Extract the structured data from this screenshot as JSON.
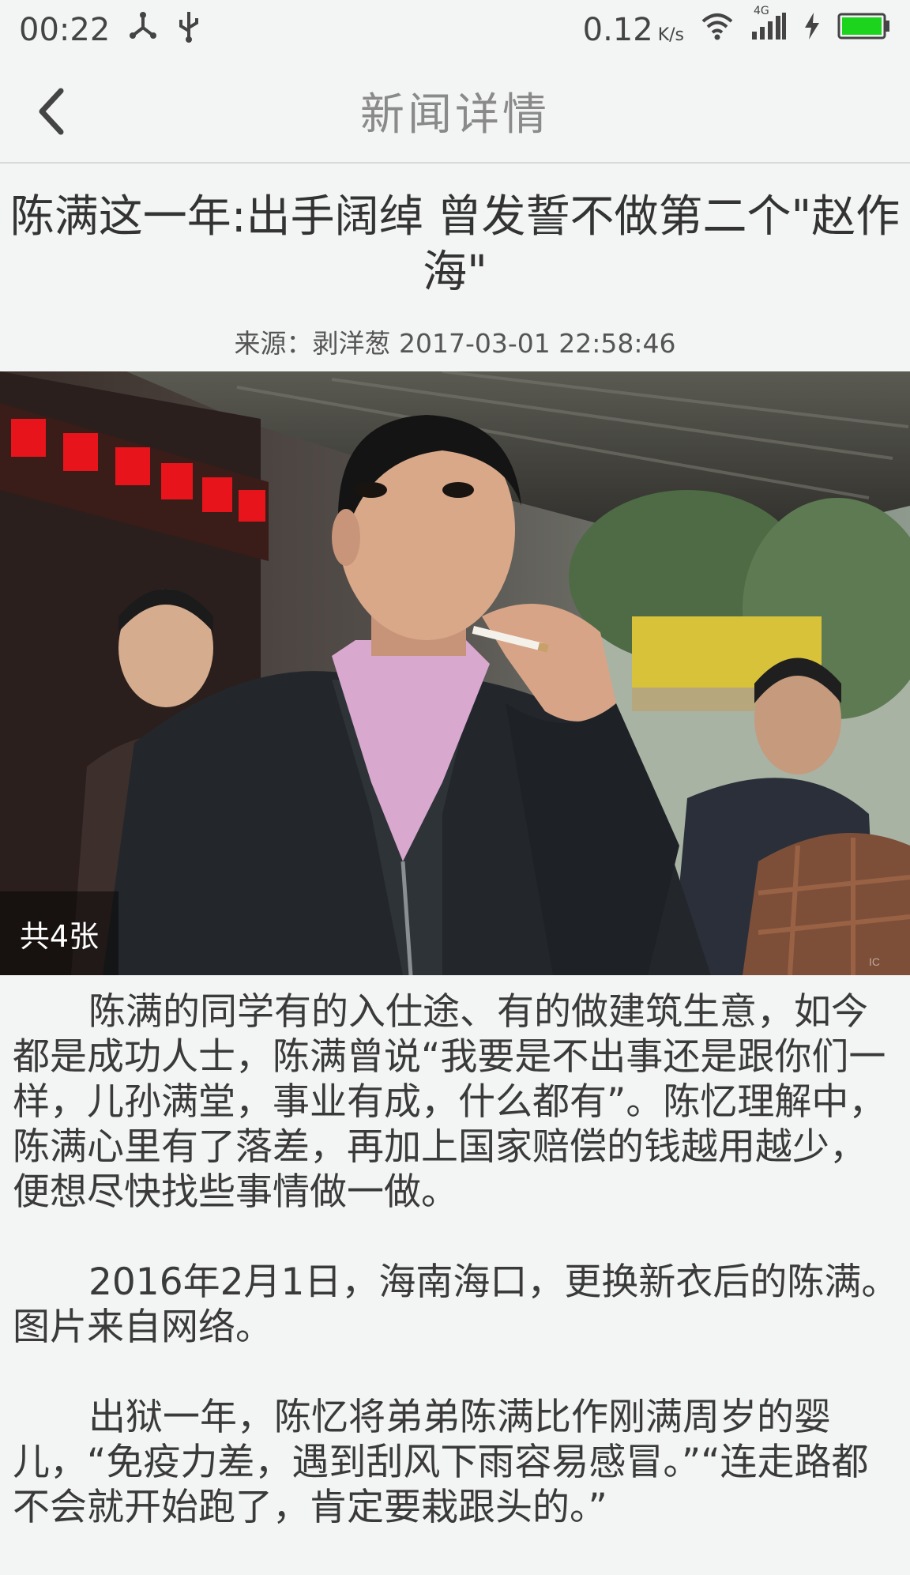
{
  "status_bar": {
    "time": "00:22",
    "speed": "0.12",
    "speed_unit": "K/s",
    "network": "4G",
    "icons": [
      "network-share-icon",
      "usb-icon",
      "wifi-icon",
      "signal-icon",
      "charging-icon",
      "battery-icon"
    ],
    "battery_color": "#1bd41b"
  },
  "nav": {
    "title": "新闻详情",
    "back_icon": "chevron-left-icon"
  },
  "article": {
    "title": "陈满这一年:出手阔绰 曾发誓不做第二个\"赵作海\"",
    "meta": "来源：剥洋葱 2017-03-01 22:58:46",
    "photo_count": "共4张",
    "paragraphs": [
      "陈满的同学有的入仕途、有的做建筑生意，如今都是成功人士，陈满曾说“我要是不出事还是跟你们一样，儿孙满堂，事业有成，什么都有”。陈忆理解中，陈满心里有了落差，再加上国家赔偿的钱越用越少，便想尽快找些事情做一做。",
      "2016年2月1日，海南海口，更换新衣后的陈满。图片来自网络。",
      "出狱一年，陈忆将弟弟陈满比作刚满周岁的婴儿，“免疫力差，遇到刮风下雨容易感冒。”“连走路都不会就开始跑了，肯定要栽跟头的。”"
    ]
  },
  "colors": {
    "background": "#f3f4f4",
    "title_text": "#333333",
    "nav_text": "#8a8a8a"
  }
}
